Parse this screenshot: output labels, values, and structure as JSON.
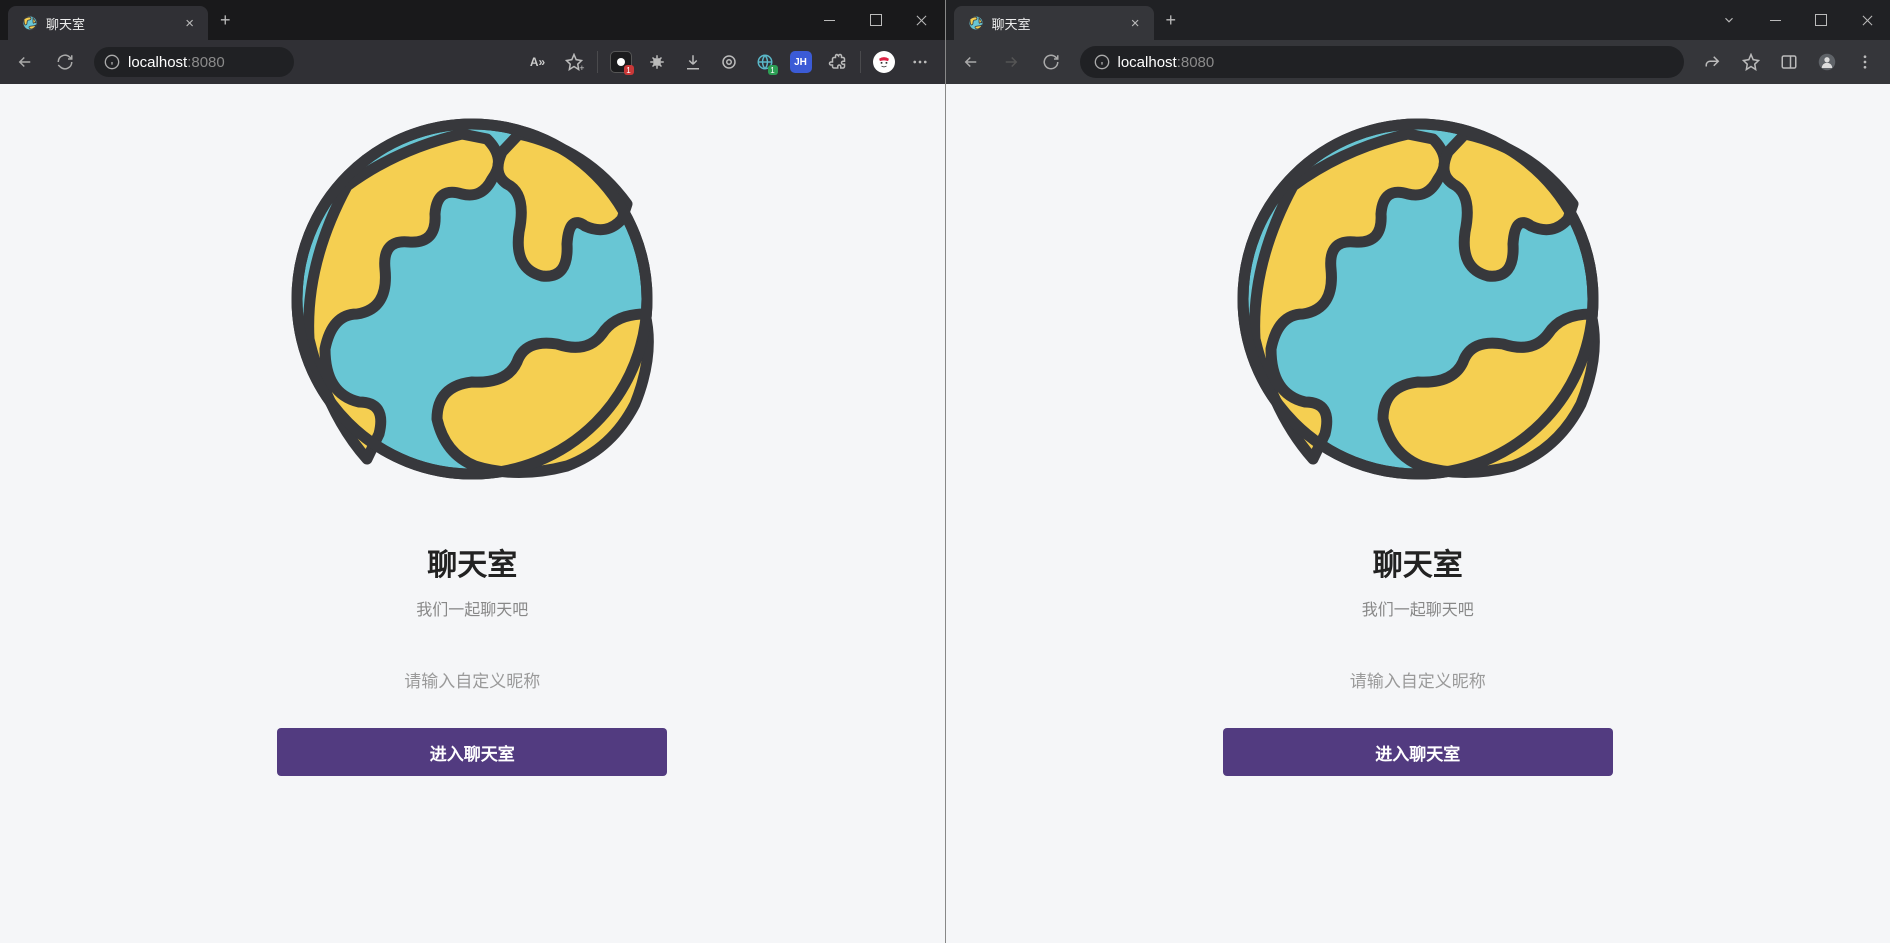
{
  "left": {
    "tab_title": "聊天室",
    "url_host": "localhost",
    "url_port": ":8080",
    "toolbar": {
      "read_aloud_label": "A»",
      "ext_badge_1": "1",
      "ext_jh_label": "JH",
      "ext_green_badge": "1"
    },
    "page": {
      "title": "聊天室",
      "subtitle": "我们一起聊天吧",
      "nickname_placeholder": "请输入自定义昵称",
      "enter_label": "进入聊天室"
    }
  },
  "right": {
    "tab_title": "聊天室",
    "url_host": "localhost",
    "url_port": ":8080",
    "page": {
      "title": "聊天室",
      "subtitle": "我们一起聊天吧",
      "nickname_placeholder": "请输入自定义昵称",
      "enter_label": "进入聊天室"
    }
  }
}
